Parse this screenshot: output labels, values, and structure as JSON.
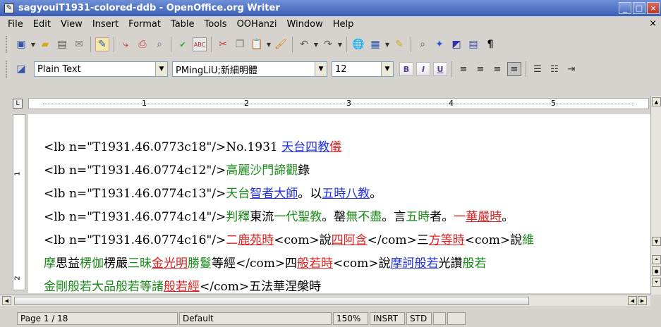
{
  "window": {
    "title": "sagyouiT1931-colored-ddb - OpenOffice.org Writer",
    "minimize": "_",
    "maximize": "□",
    "close": "×"
  },
  "menu": {
    "items": [
      "File",
      "Edit",
      "View",
      "Insert",
      "Format",
      "Table",
      "Tools",
      "OOHanzi",
      "Window",
      "Help"
    ],
    "close_doc": "×"
  },
  "format_bar": {
    "style": "Plain Text",
    "font": "PMingLiU;新細明體",
    "size": "12",
    "bold": "B",
    "italic": "I",
    "underline": "U"
  },
  "ruler": {
    "numbers": [
      "1",
      "2",
      "3",
      "4",
      "5"
    ],
    "vertical_numbers": [
      "1",
      "2"
    ]
  },
  "document": {
    "line0": [
      {
        "t": "<lb n=\"T1931.46.0773c18\"/>No.1931 ",
        "c": ""
      },
      {
        "t": "天台四教",
        "c": "b"
      },
      {
        "t": "儀",
        "c": "r"
      }
    ],
    "line1": [
      {
        "t": "<lb n=\"T1931.46.0774c12\"/>",
        "c": ""
      },
      {
        "t": "高麗沙門諦觀",
        "c": "g"
      },
      {
        "t": "錄",
        "c": ""
      }
    ],
    "line2": [
      {
        "t": "<lb n=\"T1931.46.0774c13\"/>",
        "c": ""
      },
      {
        "t": "天台",
        "c": "g"
      },
      {
        "t": "智者大師",
        "c": "b"
      },
      {
        "t": "。以",
        "c": ""
      },
      {
        "t": "五時八教",
        "c": "b"
      },
      {
        "t": "。",
        "c": ""
      }
    ],
    "line3": [
      {
        "t": "<lb n=\"T1931.46.0774c14\"/>",
        "c": ""
      },
      {
        "t": "判釋",
        "c": "g"
      },
      {
        "t": "東流",
        "c": ""
      },
      {
        "t": "一代聖教",
        "c": "g"
      },
      {
        "t": "。罄",
        "c": ""
      },
      {
        "t": "無不盡",
        "c": "g"
      },
      {
        "t": "。言",
        "c": ""
      },
      {
        "t": "五時",
        "c": "g"
      },
      {
        "t": "者。",
        "c": ""
      },
      {
        "t": "一",
        "c": "rp"
      },
      {
        "t": "華嚴時",
        "c": "r"
      },
      {
        "t": "。",
        "c": ""
      }
    ],
    "line4": [
      {
        "t": "<lb n=\"T1931.46.0774c16\"/>",
        "c": ""
      },
      {
        "t": "二",
        "c": "rp"
      },
      {
        "t": "鹿苑時",
        "c": "r"
      },
      {
        "t": "<com>說",
        "c": ""
      },
      {
        "t": "四阿含",
        "c": "r"
      },
      {
        "t": "</com>三",
        "c": ""
      },
      {
        "t": "方等時",
        "c": "r"
      },
      {
        "t": "<com>說",
        "c": ""
      },
      {
        "t": "維",
        "c": "g"
      }
    ],
    "line5": [
      {
        "t": "摩",
        "c": "g"
      },
      {
        "t": "思益",
        "c": ""
      },
      {
        "t": "楞伽",
        "c": "g"
      },
      {
        "t": "楞嚴",
        "c": ""
      },
      {
        "t": "三昧",
        "c": "g"
      },
      {
        "t": "金光明",
        "c": "r"
      },
      {
        "t": "勝鬘",
        "c": "g"
      },
      {
        "t": "等經</com>四",
        "c": ""
      },
      {
        "t": "般若時",
        "c": "r"
      },
      {
        "t": "<com>說",
        "c": ""
      },
      {
        "t": "摩訶般若",
        "c": "b"
      },
      {
        "t": "光讚",
        "c": ""
      },
      {
        "t": "般若",
        "c": "g"
      }
    ],
    "line6": [
      {
        "t": "金剛般若大品般若等諸",
        "c": "g"
      },
      {
        "t": "般若經",
        "c": "r"
      },
      {
        "t": "</com>五法華涅槃時",
        "c": ""
      }
    ]
  },
  "status": {
    "page": "Page 1 / 18",
    "style": "Default",
    "zoom": "150%",
    "insert": "INSRT",
    "selection": "STD"
  }
}
